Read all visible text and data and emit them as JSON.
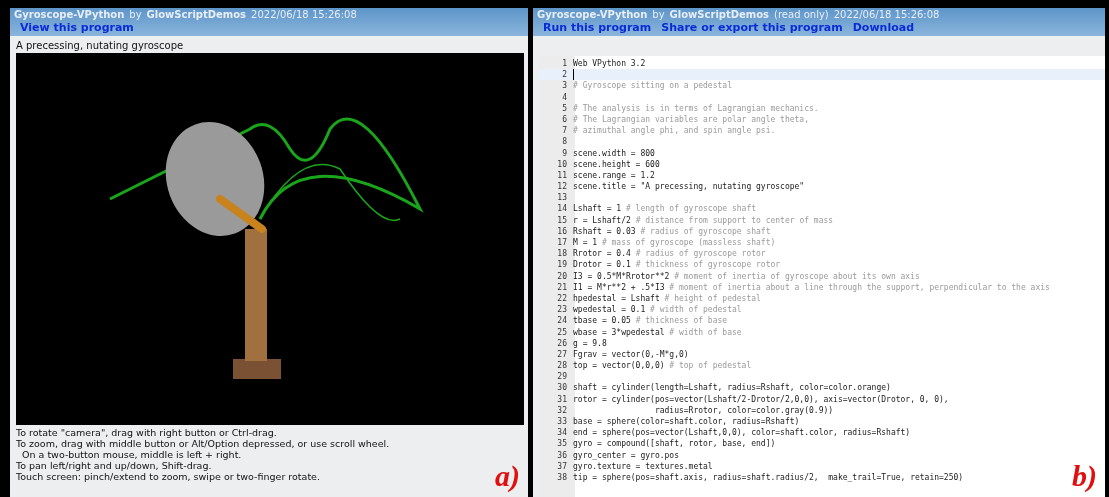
{
  "left": {
    "header": {
      "title": "Gyroscope-VPython",
      "by": "by",
      "author": "GlowScriptDemos",
      "timestamp": "2022/06/18 15:26:08",
      "links": [
        "View this program"
      ]
    },
    "caption": "A precessing, nutating gyroscope",
    "instructions": [
      "To rotate \"camera\", drag with right button or Ctrl-drag.",
      "To zoom, drag with middle button or Alt/Option depressed, or use scroll wheel.",
      "  On a two-button mouse, middle is left + right.",
      "To pan left/right and up/down, Shift-drag.",
      "Touch screen: pinch/extend to zoom, swipe or two-finger rotate."
    ],
    "panel_label": "a)"
  },
  "right": {
    "header": {
      "title": "Gyroscope-VPython",
      "by": "by",
      "author": "GlowScriptDemos",
      "note": "(read only)",
      "timestamp": "2022/06/18 15:26:08",
      "links": [
        "Run this program",
        "Share or export this program",
        "Download"
      ]
    },
    "code": [
      {
        "n": "1",
        "code": "Web VPython 3.2"
      },
      {
        "n": "2",
        "cursor": true
      },
      {
        "n": "3",
        "comment": "# Gyroscope sitting on a pedestal"
      },
      {
        "n": "4"
      },
      {
        "n": "5",
        "comment": "# The analysis is in terms of Lagrangian mechanics."
      },
      {
        "n": "6",
        "comment": "# The Lagrangian variables are polar angle theta,"
      },
      {
        "n": "7",
        "comment": "# azimuthal angle phi, and spin angle psi."
      },
      {
        "n": "8"
      },
      {
        "n": "9",
        "code": "scene.width = 800"
      },
      {
        "n": "10",
        "code": "scene.height = 600"
      },
      {
        "n": "11",
        "code": "scene.range = 1.2"
      },
      {
        "n": "12",
        "code": "scene.title = \"A precessing, nutating gyroscope\""
      },
      {
        "n": "13"
      },
      {
        "n": "14",
        "code": "Lshaft = 1 ",
        "comment": "# length of gyroscope shaft"
      },
      {
        "n": "15",
        "code": "r = Lshaft/2 ",
        "comment": "# distance from support to center of mass"
      },
      {
        "n": "16",
        "code": "Rshaft = 0.03 ",
        "comment": "# radius of gyroscope shaft"
      },
      {
        "n": "17",
        "code": "M = 1 ",
        "comment": "# mass of gyroscope (massless shaft)"
      },
      {
        "n": "18",
        "code": "Rrotor = 0.4 ",
        "comment": "# radius of gyroscope rotor"
      },
      {
        "n": "19",
        "code": "Drotor = 0.1 ",
        "comment": "# thickness of gyroscope rotor"
      },
      {
        "n": "20",
        "code": "I3 = 0.5*M*Rrotor**2 ",
        "comment": "# moment of inertia of gyroscope about its own axis"
      },
      {
        "n": "21",
        "code": "I1 = M*r**2 + .5*I3 ",
        "comment": "# moment of inertia about a line through the support, perpendicular to the axis"
      },
      {
        "n": "22",
        "code": "hpedestal = Lshaft ",
        "comment": "# height of pedestal"
      },
      {
        "n": "23",
        "code": "wpedestal = 0.1 ",
        "comment": "# width of pedestal"
      },
      {
        "n": "24",
        "code": "tbase = 0.05 ",
        "comment": "# thickness of base"
      },
      {
        "n": "25",
        "code": "wbase = 3*wpedestal ",
        "comment": "# width of base"
      },
      {
        "n": "26",
        "code": "g = 9.8"
      },
      {
        "n": "27",
        "code": "Fgrav = vector(0,-M*g,0)"
      },
      {
        "n": "28",
        "code": "top = vector(0,0,0) ",
        "comment": "# top of pedestal"
      },
      {
        "n": "29"
      },
      {
        "n": "30",
        "code": "shaft = cylinder(length=Lshaft, radius=Rshaft, color=color.orange)"
      },
      {
        "n": "31",
        "code": "rotor = cylinder(pos=vector(Lshaft/2-Drotor/2,0,0), axis=vector(Drotor, 0, 0),"
      },
      {
        "n": "32",
        "code": "                 radius=Rrotor, color=color.gray(0.9))"
      },
      {
        "n": "33",
        "code": "base = sphere(color=shaft.color, radius=Rshaft)"
      },
      {
        "n": "34",
        "code": "end = sphere(pos=vector(Lshaft,0,0), color=shaft.color, radius=Rshaft)"
      },
      {
        "n": "35",
        "code": "gyro = compound([shaft, rotor, base, end])"
      },
      {
        "n": "36",
        "code": "gyro_center = gyro.pos"
      },
      {
        "n": "37",
        "code": "gyro.texture = textures.metal"
      },
      {
        "n": "38",
        "code": "tip = sphere(pos=shaft.axis, radius=shaft.radius/2,  make_trail=True, retain=250)"
      }
    ],
    "panel_label": "b)"
  }
}
